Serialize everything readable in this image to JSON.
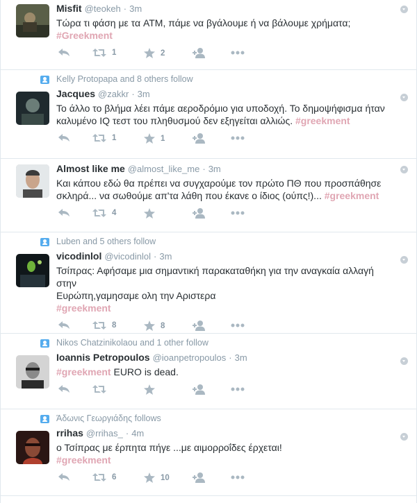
{
  "tweets": [
    {
      "context": "",
      "fullname": "Misfit",
      "username": "@teokeh",
      "time": "3m",
      "text_lines": [
        "Τώρα τι φάση με τα ATM, πάμε να βγάλουμε ή να βάλουμε χρήματα;"
      ],
      "hashtag_line": "#Greekment",
      "retweets": "1",
      "favorites": "2",
      "avatar_colors": [
        "#4a4f3c",
        "#8d7b5a"
      ]
    },
    {
      "context": "Kelly Protopapa and 8 others follow",
      "fullname": "Jacques",
      "username": "@zakkr",
      "time": "3m",
      "text_lines": [
        "Το άλλο το βλήμα λέει πάμε αεροδρόμιο για υποδοχή. Το δημοψήφισμα ήταν",
        "καλυμένο IQ τεστ του πληθυσμού δεν εξηγείται αλλιώς."
      ],
      "hashtag_inline": "#greekment",
      "retweets": "1",
      "favorites": "1",
      "avatar_colors": [
        "#1f2a2e",
        "#5b6e6a"
      ]
    },
    {
      "context": "",
      "fullname": "Almost like me",
      "username": "@almost_like_me",
      "time": "3m",
      "text_lines": [
        "Και κάπου εδώ θα πρέπει να συγχαρούμε τον πρώτο ΠΘ που προσπάθησε",
        "σκληρά... να σωθούμε απ'τα λάθη που έκανε ο ίδιος (ούπς!)..."
      ],
      "hashtag_inline": "#greekment",
      "retweets": "4",
      "favorites": "",
      "avatar_colors": [
        "#d9dfe3",
        "#3b3b3b"
      ]
    },
    {
      "context": "Luben and 5 others follow",
      "fullname": "vicodinlol",
      "username": "@vicodinlol",
      "time": "3m",
      "text_lines": [
        "Τσίπρας: Αφήσαμε μια σημαντική παρακαταθήκη για την αναγκαία αλλαγή στην",
        "Ευρώπη,γαμησαμε ολη την Αριστερα"
      ],
      "hashtag_line": "#greekment",
      "retweets": "8",
      "favorites": "8",
      "avatar_colors": [
        "#10171a",
        "#6fb23a"
      ]
    },
    {
      "context": "Nikos Chatzinikolaou and 1 other follow",
      "fullname": "Ioannis Petropoulos",
      "username": "@ioanpetropoulos",
      "time": "3m",
      "text_lines": [],
      "hashtag_lead": "#greekment",
      "text_after_tag": " EURO is dead.",
      "retweets": "",
      "favorites": "",
      "avatar_colors": [
        "#bdbdbd",
        "#2b2b2b"
      ]
    },
    {
      "context": "Άδωνις Γεωργιάδης follows",
      "fullname": "rrihas",
      "username": "@rrihas_",
      "time": "4m",
      "text_lines": [
        "ο Τσίπρας με έρπητα πήγε ...με αιμορροΐδες έρχεται!"
      ],
      "hashtag_line": "#greekment",
      "retweets": "6",
      "favorites": "10",
      "avatar_colors": [
        "#3a1d1a",
        "#b0402e"
      ]
    }
  ],
  "colors": {
    "hashtag": "#e0a6b3",
    "meta": "#8899a6",
    "icon": "#aab8c2",
    "context_icon": "#55acee"
  },
  "icons": [
    "reply-icon",
    "retweet-icon",
    "favorite-star-icon",
    "follow-user-icon",
    "more-options-icon",
    "caret-down-icon",
    "follow-context-icon"
  ]
}
